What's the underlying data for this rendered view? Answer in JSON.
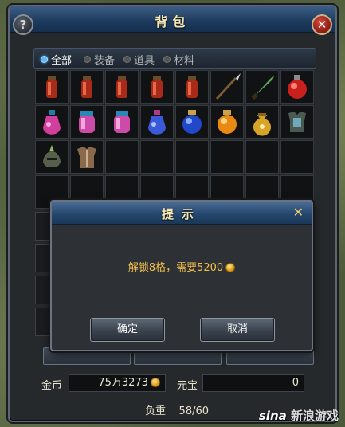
{
  "window": {
    "title": "背包",
    "help_label": "?",
    "close_label": "✕"
  },
  "tabs": [
    {
      "label": "全部",
      "active": true
    },
    {
      "label": "装备",
      "active": false
    },
    {
      "label": "道具",
      "active": false
    },
    {
      "label": "材料",
      "active": false
    }
  ],
  "inventory": {
    "columns": 8,
    "rows": 4,
    "items": [
      "red-vial-icon",
      "red-vial-icon",
      "red-vial-icon",
      "red-vial-icon",
      "red-vial-icon",
      "spear-icon",
      "green-dagger-icon",
      "red-potion-icon",
      "pink-potion-icon",
      "pink-jar-icon",
      "pink-jar-icon",
      "blue-potion-icon",
      "blue-flask-icon",
      "orange-flask-icon",
      "gold-bag-icon",
      "chest-armor-icon",
      "helmet-icon",
      "leather-armor-icon",
      "",
      "",
      "",
      "",
      "",
      "",
      "",
      "",
      "",
      "",
      "",
      "",
      "",
      ""
    ]
  },
  "footer": {
    "gold_label": "金币",
    "gold_value": "75万3273",
    "yuanbao_label": "元宝",
    "yuanbao_value": "0",
    "weight_label": "负重",
    "weight_value": "58/60"
  },
  "dialog": {
    "title": "提示",
    "close_label": "✕",
    "message": "解锁8格，需要5200",
    "confirm_label": "确定",
    "cancel_label": "取消"
  },
  "watermark": {
    "brand": "sina",
    "text": "新浪游戏"
  },
  "colors": {
    "title_text": "#f5e6b3",
    "message_text": "#f2c04a",
    "title_bar": "#23456c"
  }
}
